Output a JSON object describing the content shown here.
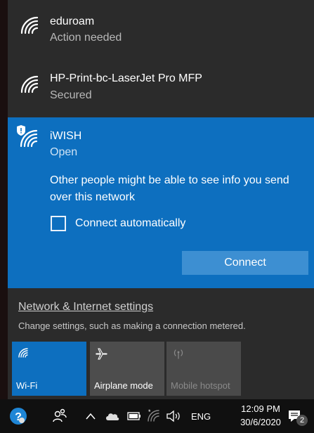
{
  "networks": [
    {
      "ssid": "eduroam",
      "status": "Action needed",
      "icon": "wifi-signal-icon"
    },
    {
      "ssid": "HP-Print-bc-LaserJet Pro MFP",
      "status": "Secured",
      "icon": "wifi-signal-icon"
    }
  ],
  "selected": {
    "ssid": "iWISH",
    "status": "Open",
    "icon": "wifi-shield-icon",
    "warning": "Other people might be able to see info you send over this network",
    "auto_connect_label": "Connect automatically",
    "auto_connect_checked": false,
    "connect_label": "Connect"
  },
  "settings": {
    "link": "Network & Internet settings",
    "description": "Change settings, such as making a connection metered."
  },
  "quick_actions": {
    "wifi": {
      "label": "Wi-Fi",
      "active": true,
      "icon": "wifi-icon"
    },
    "airplane": {
      "label": "Airplane mode",
      "active": false,
      "icon": "airplane-icon"
    },
    "hotspot": {
      "label": "Mobile hotspot",
      "active": false,
      "disabled": true,
      "icon": "hotspot-icon"
    }
  },
  "taskbar": {
    "language": "ENG",
    "time": "12:09 PM",
    "date": "30/6/2020",
    "notification_count": "2"
  },
  "colors": {
    "accent": "#0d6fbf",
    "flyout_bg": "#2b2b2b",
    "taskbar_bg": "#101010"
  }
}
